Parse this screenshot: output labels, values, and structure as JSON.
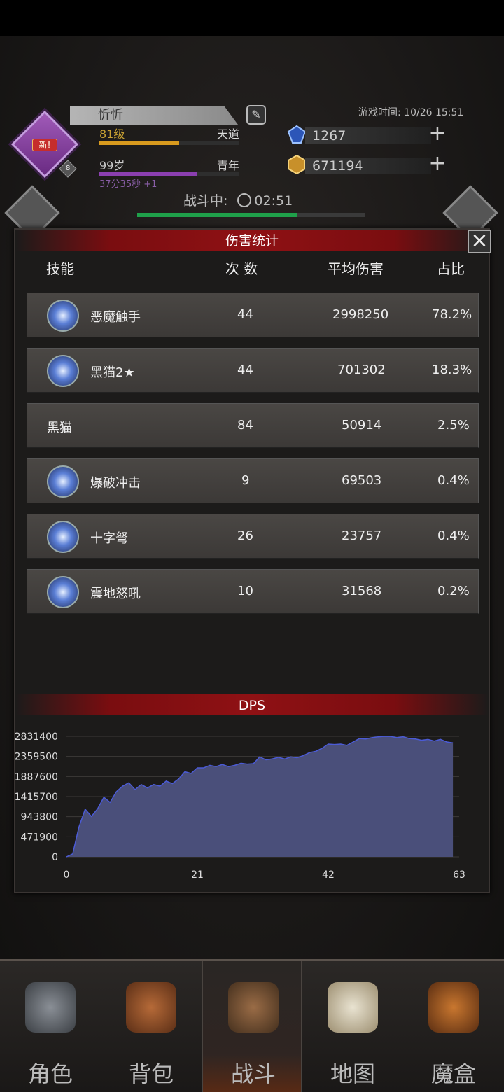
{
  "header": {
    "avatar_badge": "新!",
    "avatar_level": "8",
    "player_name": "忻忻",
    "level": "81级",
    "realm": "天道",
    "age": "99岁",
    "age_stage": "青年",
    "timer_text": "37分35秒 +1",
    "game_time": "游戏时间: 10/26 15:51",
    "gems": "1267",
    "gold": "671194",
    "plus": "+",
    "battle_label": "战斗中:",
    "battle_timer": "02:51"
  },
  "panel": {
    "title": "伤害统计",
    "close": "×",
    "columns": {
      "skill": "技能",
      "count": "次 数",
      "avg": "平均伤害",
      "ratio": "占比"
    },
    "rows": [
      {
        "name": "恶魔触手",
        "count": "44",
        "avg": "2998250",
        "ratio": "78.2%",
        "icon": "demon-tentacle-icon"
      },
      {
        "name": "黑猫2★",
        "count": "44",
        "avg": "701302",
        "ratio": "18.3%",
        "icon": "sword-icon"
      },
      {
        "name": "黑猫",
        "count": "84",
        "avg": "50914",
        "ratio": "2.5%",
        "icon": ""
      },
      {
        "name": "爆破冲击",
        "count": "9",
        "avg": "69503",
        "ratio": "0.4%",
        "icon": "blast-icon"
      },
      {
        "name": "十字弩",
        "count": "26",
        "avg": "23757",
        "ratio": "0.4%",
        "icon": "crossbow-icon"
      },
      {
        "name": "震地怒吼",
        "count": "10",
        "avg": "31568",
        "ratio": "0.2%",
        "icon": "roar-icon"
      }
    ],
    "dps_title": "DPS"
  },
  "chart_data": {
    "type": "area",
    "title": "DPS",
    "color": "#4a4f7a",
    "line_color": "#4b5bd6",
    "ylim": [
      0,
      2831400
    ],
    "yticks": [
      0,
      471900,
      943800,
      1415700,
      1887600,
      2359500,
      2831400
    ],
    "xlim": [
      0,
      63
    ],
    "xticks": [
      0,
      21,
      42,
      63
    ],
    "x": [
      0,
      1,
      2,
      3,
      4,
      5,
      6,
      7,
      8,
      9,
      10,
      11,
      12,
      13,
      14,
      15,
      16,
      17,
      18,
      19,
      20,
      21,
      22,
      23,
      24,
      25,
      26,
      27,
      28,
      29,
      30,
      31,
      32,
      33,
      34,
      35,
      36,
      37,
      38,
      39,
      40,
      41,
      42,
      43,
      44,
      45,
      46,
      47,
      48,
      49,
      50,
      51,
      52,
      53,
      54,
      55,
      56,
      57,
      58,
      59,
      60,
      61,
      62
    ],
    "values": [
      0,
      70000,
      700000,
      1120000,
      950000,
      1130000,
      1400000,
      1280000,
      1530000,
      1660000,
      1740000,
      1580000,
      1700000,
      1620000,
      1700000,
      1660000,
      1780000,
      1720000,
      1830000,
      2000000,
      1960000,
      2090000,
      2090000,
      2150000,
      2120000,
      2170000,
      2120000,
      2150000,
      2200000,
      2180000,
      2190000,
      2350000,
      2280000,
      2300000,
      2340000,
      2300000,
      2350000,
      2330000,
      2380000,
      2450000,
      2480000,
      2550000,
      2650000,
      2640000,
      2650000,
      2620000,
      2700000,
      2780000,
      2770000,
      2800000,
      2820000,
      2831400,
      2830000,
      2800000,
      2820000,
      2780000,
      2770000,
      2740000,
      2760000,
      2720000,
      2760000,
      2700000,
      2680000
    ]
  },
  "nav": [
    {
      "label": "角色",
      "icon": "helmet-icon"
    },
    {
      "label": "背包",
      "icon": "backpack-icon"
    },
    {
      "label": "战斗",
      "icon": "shield-sword-icon"
    },
    {
      "label": "地图",
      "icon": "scroll-map-icon"
    },
    {
      "label": "魔盒",
      "icon": "magic-box-icon"
    }
  ]
}
